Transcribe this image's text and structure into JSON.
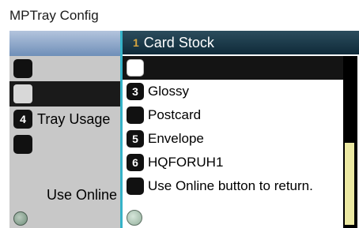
{
  "title": "MPTray Config",
  "left": {
    "rows": [
      {
        "num": "",
        "label": "",
        "selected": false
      },
      {
        "num": "",
        "label": "",
        "selected": true
      },
      {
        "num": "4",
        "label": "Tray Usage"
      },
      {
        "num": "",
        "label": ""
      },
      {
        "num": "",
        "label": ""
      },
      {
        "num": "",
        "label": "Use Online"
      }
    ]
  },
  "right": {
    "header": {
      "num": "1",
      "label": "Card Stock"
    },
    "rows": [
      {
        "num": "",
        "label": "",
        "selected": true
      },
      {
        "num": "3",
        "label": "Glossy"
      },
      {
        "num": "",
        "label": "Postcard"
      },
      {
        "num": "5",
        "label": "Envelope"
      },
      {
        "num": "6",
        "label": "HQFORUH1"
      },
      {
        "num": "",
        "label": "Use Online button to return."
      }
    ]
  },
  "colors": {
    "header_dark": "#0f2a39",
    "header_num": "#d6a43f",
    "left_header": "#6f8fb8",
    "scroll_thumb": "#ece9a3",
    "edge_accent": "#35b3c8"
  }
}
